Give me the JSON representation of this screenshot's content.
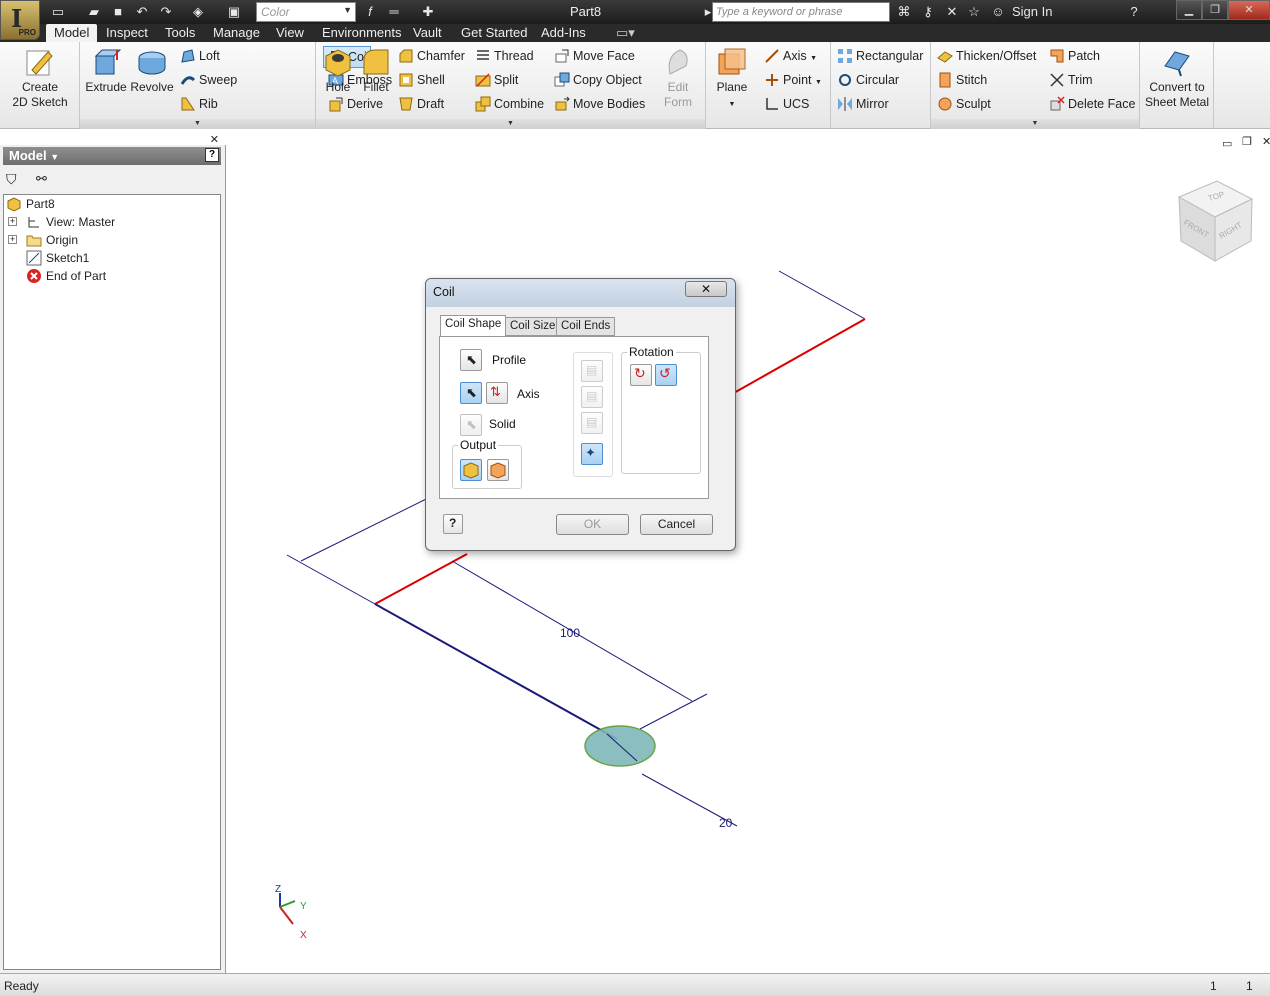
{
  "app": {
    "badge": "PRO",
    "doc_title": "Part8"
  },
  "qat": {
    "color_select": "Color",
    "search_placeholder": "Type a keyword or phrase",
    "sign_in": "Sign In"
  },
  "tabs": [
    "Model",
    "Inspect",
    "Tools",
    "Manage",
    "View",
    "Environments",
    "Vault",
    "Get Started",
    "Add-Ins"
  ],
  "ribbon": {
    "sketch": {
      "create_l1": "Create",
      "create_l2": "2D Sketch"
    },
    "create": {
      "extrude": "Extrude",
      "revolve": "Revolve",
      "loft": "Loft",
      "sweep": "Sweep",
      "rib": "Rib",
      "coil": "Coil",
      "emboss": "Emboss",
      "derive": "Derive"
    },
    "modify": {
      "hole": "Hole",
      "fillet": "Fillet",
      "chamfer": "Chamfer",
      "shell": "Shell",
      "draft": "Draft",
      "thread": "Thread",
      "split": "Split",
      "combine": "Combine",
      "move_face": "Move Face",
      "copy_object": "Copy Object",
      "move_bodies": "Move Bodies"
    },
    "freeform": {
      "l1": "Edit",
      "l2": "Form"
    },
    "work": {
      "plane": "Plane",
      "axis": "Axis",
      "point": "Point",
      "ucs": "UCS"
    },
    "pattern": {
      "rectangular": "Rectangular",
      "circular": "Circular",
      "mirror": "Mirror"
    },
    "surface": {
      "thicken": "Thicken/Offset",
      "stitch": "Stitch",
      "sculpt": "Sculpt",
      "patch": "Patch",
      "trim": "Trim",
      "delete_face": "Delete Face"
    },
    "convert": {
      "l1": "Convert to",
      "l2": "Sheet Metal"
    }
  },
  "browser": {
    "title": "Model",
    "tree": [
      {
        "label": "Part8"
      },
      {
        "label": "View: Master"
      },
      {
        "label": "Origin"
      },
      {
        "label": "Sketch1"
      },
      {
        "label": "End of Part"
      }
    ]
  },
  "viewcube": {
    "top": "TOP",
    "front": "FRONT",
    "right": "RIGHT"
  },
  "dimensions": {
    "length": "100",
    "diameter": "20"
  },
  "triad": {
    "z": "Z",
    "y": "Y",
    "x": "X"
  },
  "dialog": {
    "title": "Coil",
    "close": "✕",
    "tabs": [
      "Coil Shape",
      "Coil Size",
      "Coil Ends"
    ],
    "profile": "Profile",
    "axis": "Axis",
    "solid": "Solid",
    "output": "Output",
    "rotation": "Rotation",
    "ok": "OK",
    "cancel": "Cancel"
  },
  "status": {
    "text": "Ready",
    "count1": "1",
    "count2": "1"
  }
}
